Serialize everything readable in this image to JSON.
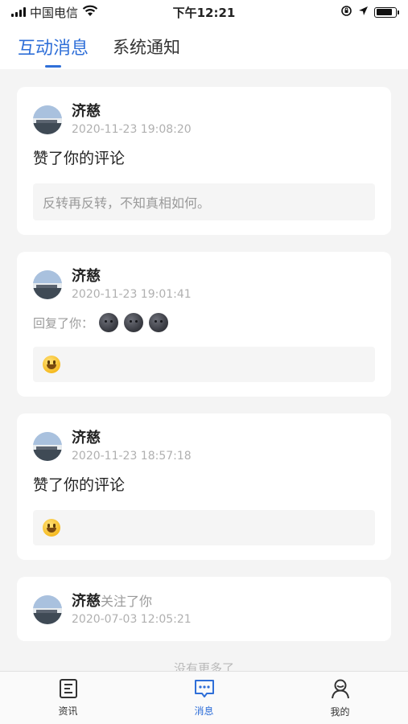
{
  "status_bar": {
    "carrier": "中国电信",
    "time": "下午12:21"
  },
  "tabs": [
    {
      "label": "互动消息",
      "active": true
    },
    {
      "label": "系统通知",
      "active": false
    }
  ],
  "messages": [
    {
      "user": "济慈",
      "time": "2020-11-23 19:08:20",
      "text": "赞了你的评论",
      "quote": "反转再反转，不知真相如何。"
    },
    {
      "user": "济慈",
      "time": "2020-11-23 19:01:41",
      "reply_prefix": "回复了你：",
      "reply_emoji": "new-moon-face x3",
      "quote_emoji": "smiley"
    },
    {
      "user": "济慈",
      "time": "2020-11-23 18:57:18",
      "text": "赞了你的评论",
      "quote_emoji": "smiley"
    },
    {
      "user": "济慈",
      "action": "关注了你",
      "time": "2020-07-03 12:05:21"
    }
  ],
  "list_end": "没有更多了",
  "bottom_nav": [
    {
      "label": "资讯",
      "icon": "news-icon",
      "active": false
    },
    {
      "label": "消息",
      "icon": "message-icon",
      "active": true
    },
    {
      "label": "我的",
      "icon": "profile-icon",
      "active": false
    }
  ],
  "colors": {
    "accent": "#2f6fd8",
    "background": "#f4f4f4",
    "muted": "#9a9a9a"
  }
}
